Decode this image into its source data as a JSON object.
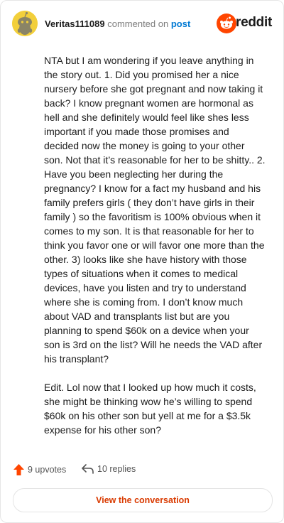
{
  "header": {
    "username": "Veritas111089",
    "action_text": "commented on",
    "post_link": "post",
    "brand": "reddit",
    "avatar_icon": "snoo-avatar-icon",
    "brand_icon": "reddit-logo-icon"
  },
  "comment": {
    "paragraphs": [
      "NTA but I am wondering if you leave anything in the story out. 1. Did you promised her a nice nursery before she got pregnant and now taking it back? I know pregnant women are hormonal as hell and she definitely would feel like shes less important if you made those promises and decided now the money is going to your other son. Not that it’s reasonable for her to be shitty.. 2. Have you been neglecting her during the pregnancy? I know for a fact my husband and his family prefers girls ( they don’t have girls in their family ) so the favoritism is 100% obvious when it comes to my son. It is that reasonable for her to think you favor one or will favor one more than the other. 3) looks like she have history with those types of situations when it comes to medical devices, have you listen and try to understand where she is coming from. I don’t know much about VAD and transplants list but are you planning to spend $60k on a device when your son is 3rd on the list? Will he needs the VAD after his transplant?",
      "Edit. Lol now that I looked up how much it costs, she might be thinking wow he’s willing to spend $60k on his other son but yell at me for a $3.5k expense for his other son?"
    ]
  },
  "stats": {
    "upvotes": "9 upvotes",
    "replies": "10 replies",
    "upvote_icon": "upvote-arrow-icon",
    "reply_icon": "reply-arrow-icon"
  },
  "actions": {
    "view_conversation": "View the conversation"
  },
  "colors": {
    "accent": "#d93a00",
    "link": "#0079d3",
    "avatar_bg": "#f2cf3b",
    "brand": "#ff4500"
  }
}
